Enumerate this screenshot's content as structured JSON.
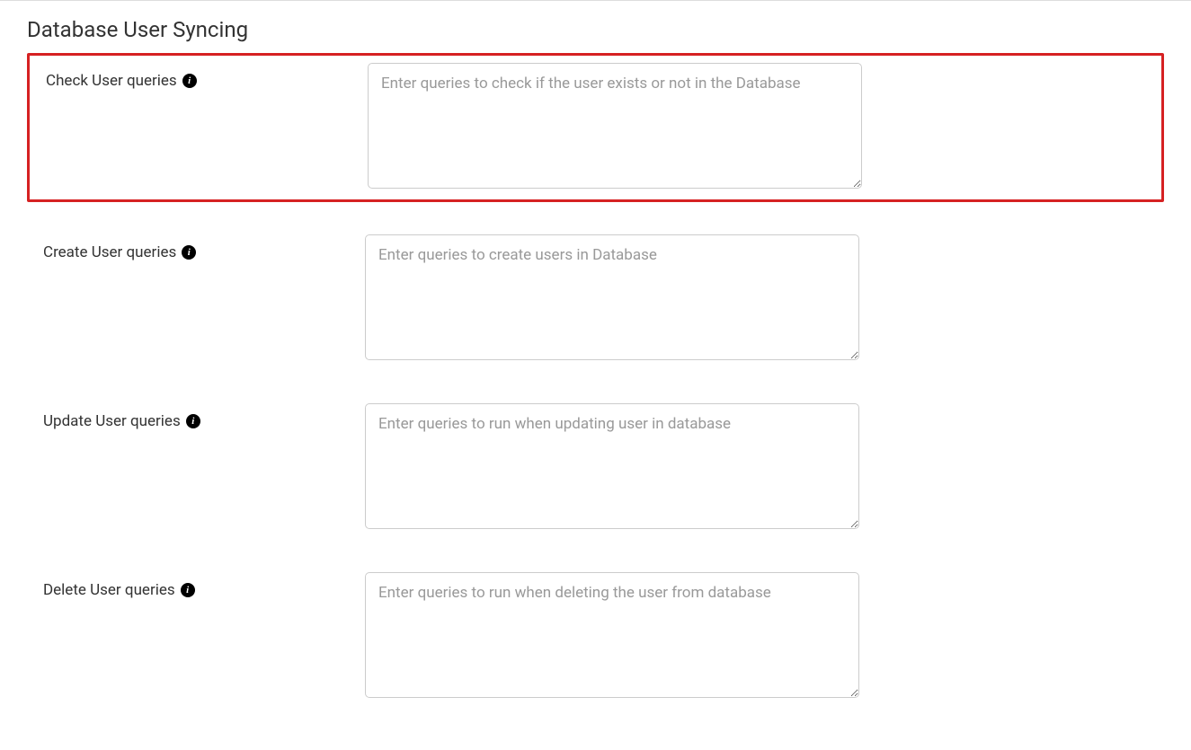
{
  "section": {
    "title": "Database User Syncing"
  },
  "fields": {
    "check_user": {
      "label": "Check User queries",
      "placeholder": "Enter queries to check if the user exists or not in the Database",
      "value": ""
    },
    "create_user": {
      "label": "Create User queries",
      "placeholder": "Enter queries to create users in Database",
      "value": ""
    },
    "update_user": {
      "label": "Update User queries",
      "placeholder": "Enter queries to run when updating user in database",
      "value": ""
    },
    "delete_user": {
      "label": "Delete User queries",
      "placeholder": "Enter queries to run when deleting the user from database",
      "value": ""
    }
  }
}
